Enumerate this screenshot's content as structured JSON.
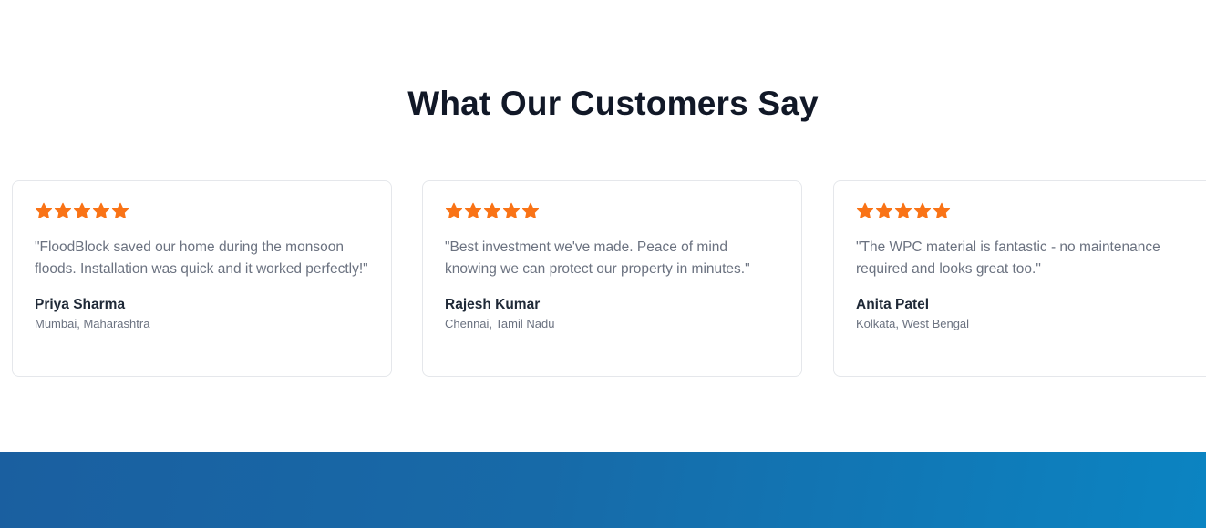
{
  "section": {
    "title": "What Our Customers Say"
  },
  "colors": {
    "star": "#f97316",
    "band_start": "#1a5fa0",
    "band_end": "#0b84c2"
  },
  "testimonials": [
    {
      "rating": 5,
      "quote": "\"FloodBlock saved our home during the monsoon floods. Installation was quick and it worked perfectly!\"",
      "name": "Priya Sharma",
      "location": "Mumbai, Maharashtra"
    },
    {
      "rating": 5,
      "quote": "\"Best investment we've made. Peace of mind knowing we can protect our property in minutes.\"",
      "name": "Rajesh Kumar",
      "location": "Chennai, Tamil Nadu"
    },
    {
      "rating": 5,
      "quote": "\"The WPC material is fantastic - no maintenance required and looks great too.\"",
      "name": "Anita Patel",
      "location": "Kolkata, West Bengal"
    }
  ]
}
